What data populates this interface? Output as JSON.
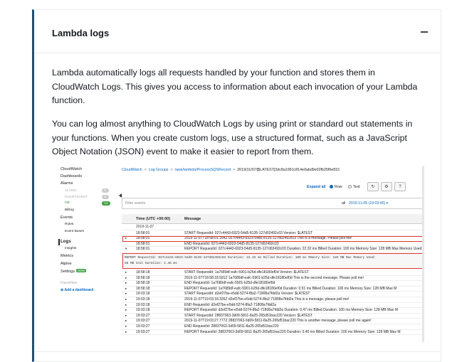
{
  "card": {
    "title": "Lambda logs",
    "paragraph1": "Lambda automatically logs all requests handled by your function and stores them in CloudWatch Logs. This gives you access to information about each invocation of your Lambda function.",
    "paragraph2": "You can log almost anything to CloudWatch Logs by using print or standard out statements in your functions. When you create custom logs, use a structured format, such as a JavaScript Object Notation (JSON) event to make it easier to report from them."
  },
  "console": {
    "nav": {
      "cloudwatch": "CloudWatch",
      "dashboards": "Dashboards",
      "alarms": "Alarms",
      "alarm": "ALARM",
      "insufficient": "INSUFFICIENT",
      "ok": "OK",
      "ok_count": "14",
      "alarm_count": "0",
      "insufficient_count": "0",
      "billing": "Billing",
      "events": "Events",
      "rules": "Rules",
      "event_buses": "Event Buses",
      "logs": "Logs",
      "insights": "Insights",
      "metrics": "Metrics",
      "alpine": "Alpine",
      "settings": "Settings",
      "new_badge": "NEW",
      "favorites": "Favorites",
      "add_dashboard": "Add a dashboard"
    },
    "breadcrumb": {
      "c1": "CloudWatch",
      "c2": "Log Groups",
      "c3": "/aws/lambda/ProcessSQSRecord",
      "c4": "2019/11/07/[$LATEST]2dc8a1991c814e0abd9e02fb25f6e815"
    },
    "toolbar": {
      "expand_all": "Expand all",
      "row": "Row",
      "text": "Text",
      "refresh_icon": "↻",
      "gear_icon": "⚙",
      "help_icon": "?"
    },
    "filter": {
      "placeholder": "Filter events",
      "all": "all",
      "date": "2019-11-05 (19:03:45) ▾"
    },
    "table": {
      "col_time": "Time (UTC +00:00)",
      "col_message": "Message",
      "date_row": "2019-11-07",
      "rows": [
        {
          "caret": "",
          "time": "18:58:01",
          "msg": "START RequestId: 027c4443-6923-54d5-8135-127d02492c03 Version: $LATEST"
        },
        {
          "caret": "▸",
          "time": "18:58:01",
          "msg": "2019-11-07T18:58:01.164Z 027c4443-6923-54d5-8135-127d02492c03 This is a message. Please poll me!"
        },
        {
          "caret": "",
          "time": "18:58:01",
          "msg": "END RequestId: 027c4443-6923-54d5-8135-127d02492c03"
        },
        {
          "caret": "▾",
          "time": "18:58:01",
          "msg": "REPORT RequestId: 027c4443-6923-54d5-8135-127d02492c03 Duration: 22.32 ms Billed Duration: 100 ms Memory Size: 128 MB Max Memory Used: 58 MB"
        }
      ],
      "detail_line1": "REPORT RequestId: 027c4443-6923-54d5-8135-127d02492c03  Duration: 22.32 ms      Billed Duration: 100 ms Memory Size: 128 MB     Max Memory Used:",
      "detail_line2": "58 MB   Init Duration: 1.46 ms",
      "rows2": [
        {
          "caret": "▸",
          "time": "18:58:18",
          "msg": "START RequestId: 1a7689df-eafc-5901-b25d-dfe18180ef0d Version: $LATEST"
        },
        {
          "caret": "▸",
          "time": "18:58:18",
          "msg": "2019-11-07T18:58:18.591Z 1a7689df-eafc-5901-b25d-dfe18180ef0d This is the second message. Please poll me!"
        },
        {
          "caret": "▸",
          "time": "18:58:18",
          "msg": "END RequestId: 1a7689df-eafc-5901-b25d-dfe18180ef0d"
        },
        {
          "caret": "▸",
          "time": "18:58:18",
          "msg": "REPORT RequestId: 1a7689df-eafc-5901-b25d-dfe18180ef0d Duration: 0.51 ms Billed Duration: 100 ms Memory Size: 128 MB Max M"
        },
        {
          "caret": "▸",
          "time": "19:03:18",
          "msg": "START RequestId: d2ef27be-e5dd-5274-8fa2-71808a7fdd2a Version: $LATEST"
        },
        {
          "caret": "▸",
          "time": "19:03:18",
          "msg": "2019-11-07T19:03:18.326Z d2ef27be-e5dd-5274-8fa2-71808a7fdd2a This is a message, please poll me!"
        },
        {
          "caret": "▸",
          "time": "19:03:18",
          "msg": "END RequestId: d2ef27be-e5dd-5274-8fa2-71808a7fdd2a"
        },
        {
          "caret": "▸",
          "time": "19:03:18",
          "msg": "REPORT RequestId: d2ef27be-e5dd-5274-8fa2-71808a7fdd2a Duration: 0.47 ms Billed Duration: 100 ms Memory Size: 128 MB Max M"
        },
        {
          "caret": "▸",
          "time": "19:03:27",
          "msg": "START RequestId: 28837063-3d09-5811-8a25-265d51bac220 Version: $LATEST"
        },
        {
          "caret": "▸",
          "time": "19:03:27",
          "msg": "2019-11-07T19:03:27.777Z 28837063-3d09-5811-8a25-265d51bac220 This is another message, please poll me again!"
        },
        {
          "caret": "▸",
          "time": "19:03:27",
          "msg": "END RequestId: 28837063-3d09-5811-8a25-265d51bac220"
        },
        {
          "caret": "▸",
          "time": "19:03:27",
          "msg": "REPORT RequestId: 28837063-3d09-5811-8a25-265d51bac220 Duration: 0.40 ms Billed Duration: 100 ms Memory Size: 128 MB Max M"
        }
      ]
    }
  }
}
